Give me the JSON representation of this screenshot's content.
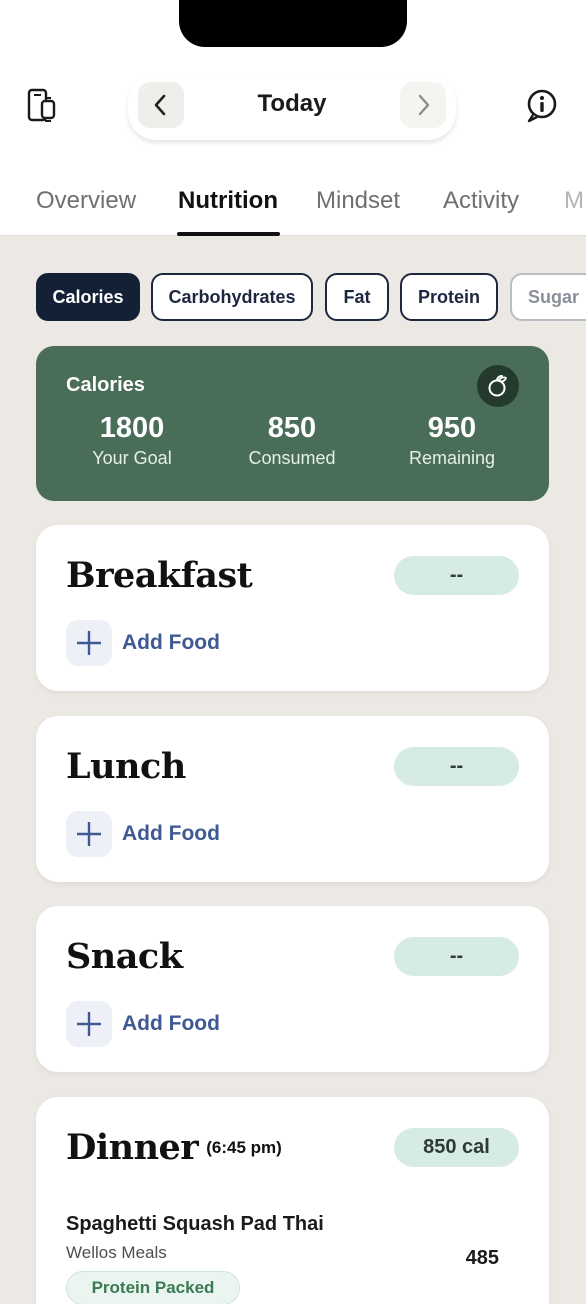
{
  "header": {
    "date_label": "Today",
    "left_icon": "device-sync-icon",
    "right_icon": "info-icon",
    "prev_icon": "chevron-left-icon",
    "next_icon": "chevron-right-icon"
  },
  "tabs": [
    {
      "label": "Overview",
      "active": false
    },
    {
      "label": "Nutrition",
      "active": true
    },
    {
      "label": "Mindset",
      "active": false
    },
    {
      "label": "Activity",
      "active": false
    },
    {
      "label": "M",
      "active": false
    }
  ],
  "filters": [
    {
      "label": "Calories",
      "active": true
    },
    {
      "label": "Carbohydrates",
      "active": false
    },
    {
      "label": "Fat",
      "active": false
    },
    {
      "label": "Protein",
      "active": false
    },
    {
      "label": "Sugar",
      "active": false
    }
  ],
  "calories_card": {
    "title": "Calories",
    "icon": "apple-icon",
    "stats": [
      {
        "value": "1800",
        "label": "Your Goal"
      },
      {
        "value": "850",
        "label": "Consumed"
      },
      {
        "value": "950",
        "label": "Remaining"
      }
    ]
  },
  "meals": [
    {
      "title": "Breakfast",
      "badge": "--",
      "add_label": "Add Food"
    },
    {
      "title": "Lunch",
      "badge": "--",
      "add_label": "Add Food"
    },
    {
      "title": "Snack",
      "badge": "--",
      "add_label": "Add Food"
    },
    {
      "title": "Dinner",
      "time": "(6:45 pm)",
      "badge": "850 cal",
      "items": [
        {
          "name": "Spaghetti Squash Pad Thai",
          "brand": "Wellos Meals",
          "calories": "485",
          "tag": "Protein Packed"
        }
      ]
    }
  ],
  "colors": {
    "accent_green": "#4a6d58",
    "navy": "#142036",
    "badge_green": "#d6ebe2",
    "link_blue": "#3f5a93"
  }
}
